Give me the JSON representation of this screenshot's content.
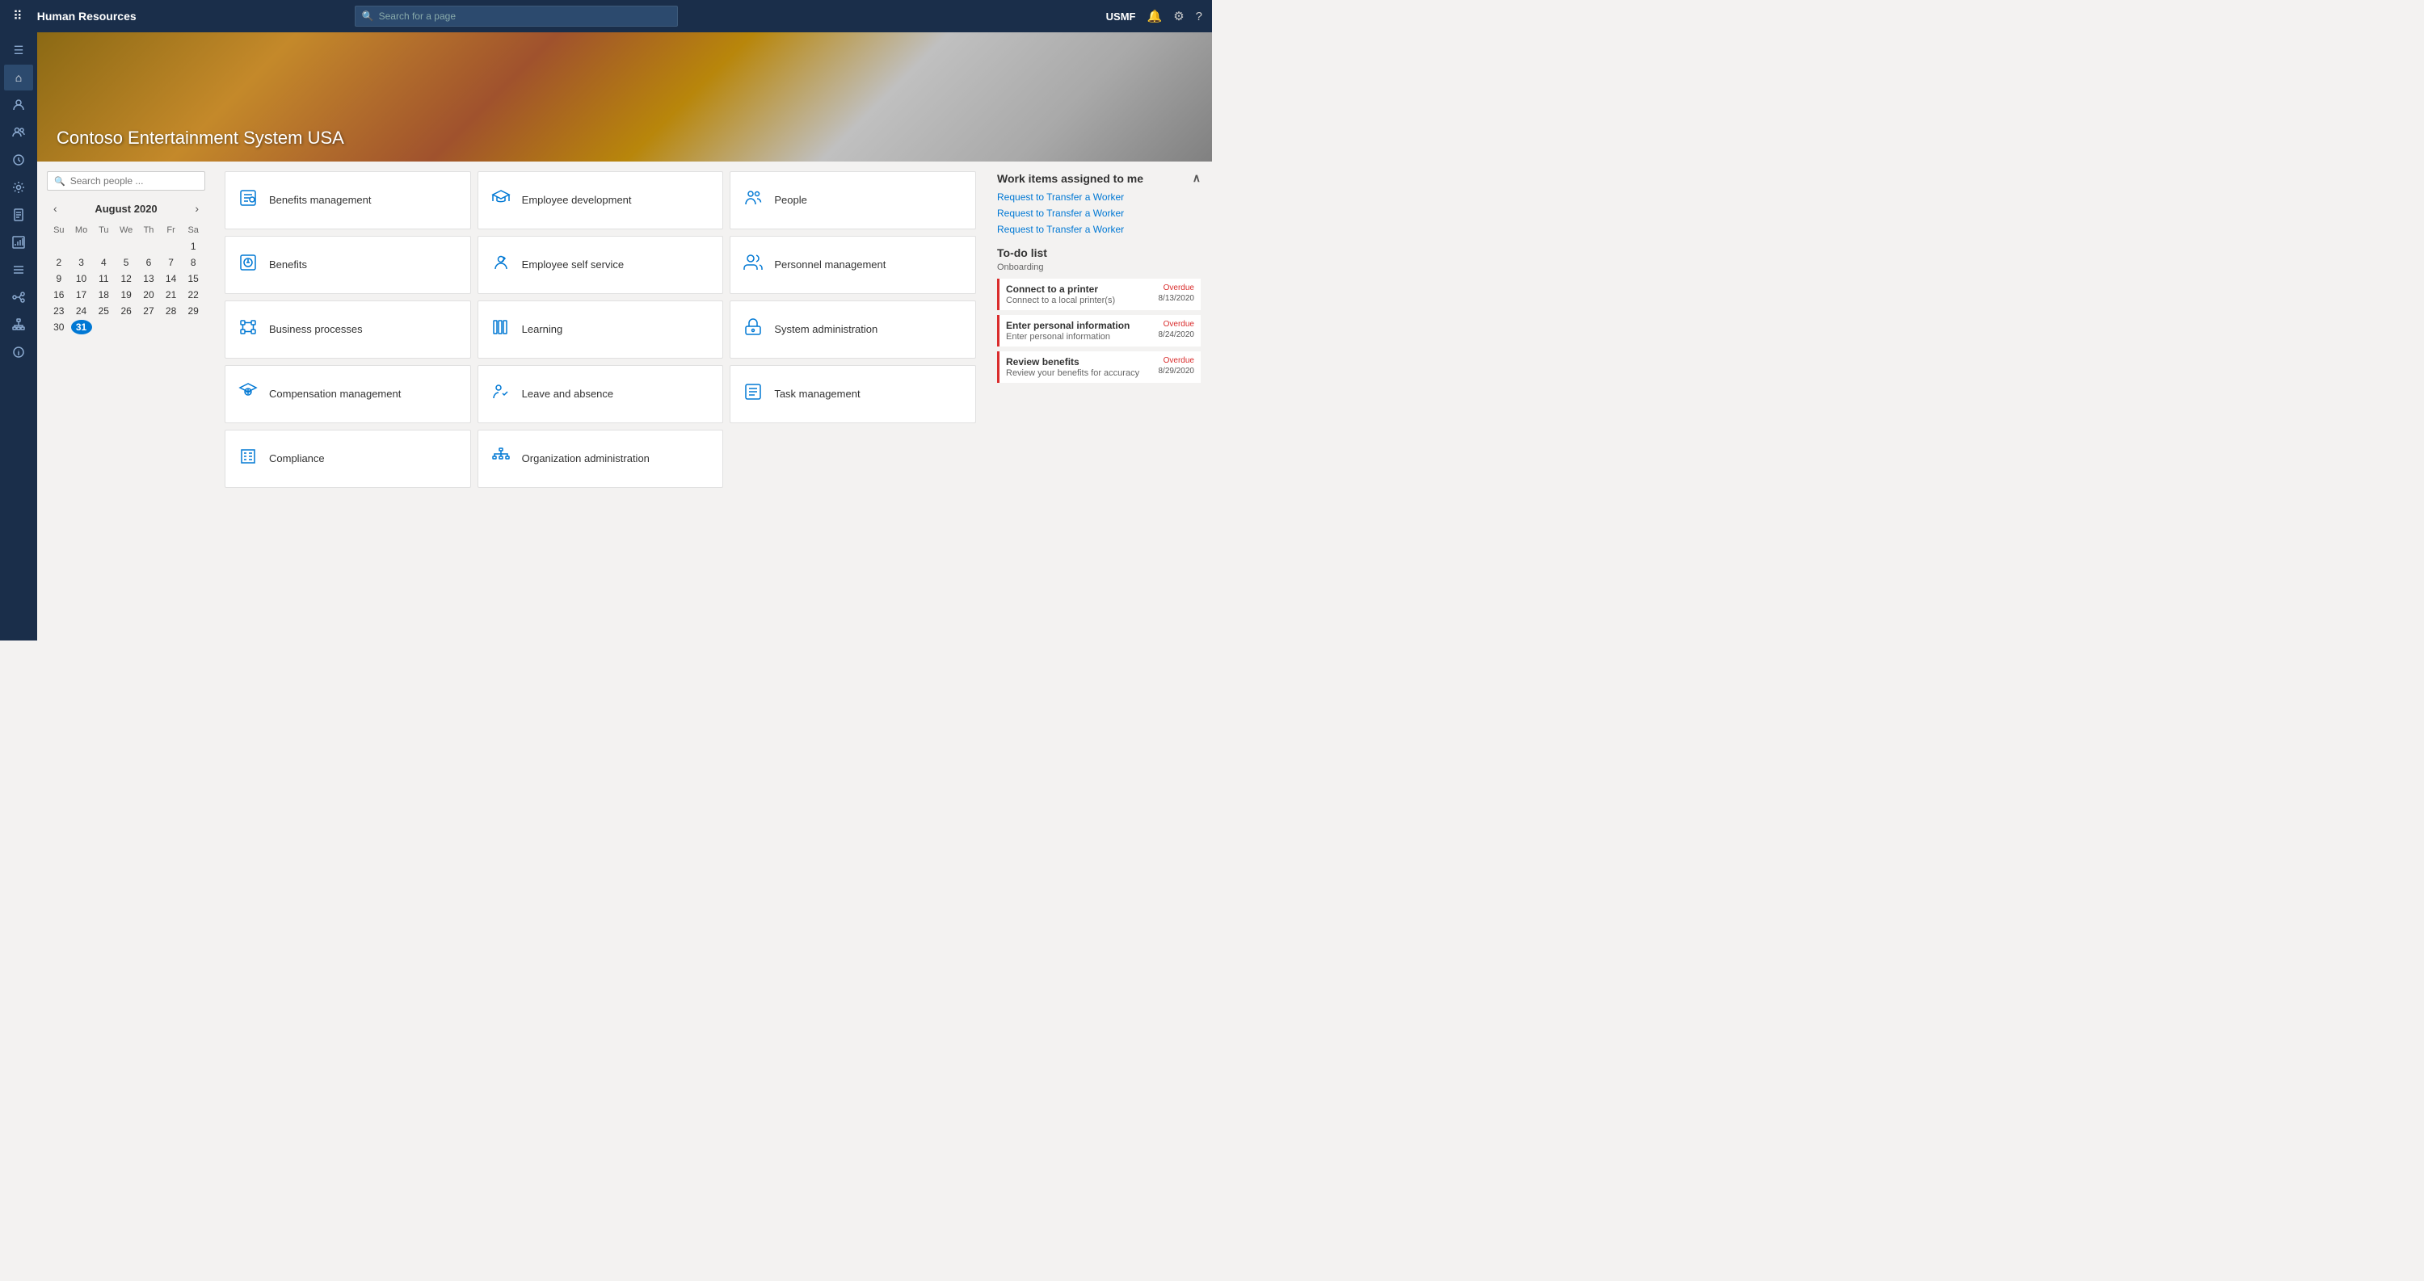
{
  "topNav": {
    "title": "Human Resources",
    "searchPlaceholder": "Search for a page",
    "company": "USMF"
  },
  "hero": {
    "title": "Contoso Entertainment System USA"
  },
  "searchPeople": {
    "placeholder": "Search people ..."
  },
  "calendar": {
    "month": "August",
    "year": "2020",
    "days": [
      "Su",
      "Mo",
      "Tu",
      "We",
      "Th",
      "Fr",
      "Sa"
    ],
    "weeks": [
      [
        "",
        "",
        "",
        "",
        "",
        "",
        "1"
      ],
      [
        "2",
        "3",
        "4",
        "5",
        "6",
        "7",
        "8"
      ],
      [
        "9",
        "10",
        "11",
        "12",
        "13",
        "14",
        "15"
      ],
      [
        "16",
        "17",
        "18",
        "19",
        "20",
        "21",
        "22"
      ],
      [
        "23",
        "24",
        "25",
        "26",
        "27",
        "28",
        "29"
      ],
      [
        "30",
        "31",
        "",
        "",
        "",
        "",
        ""
      ]
    ],
    "today": "31"
  },
  "tiles": [
    {
      "id": "benefits-management",
      "label": "Benefits management",
      "icon": "bm"
    },
    {
      "id": "employee-development",
      "label": "Employee development",
      "icon": "ed"
    },
    {
      "id": "people",
      "label": "People",
      "icon": "people"
    },
    {
      "id": "benefits",
      "label": "Benefits",
      "icon": "ben"
    },
    {
      "id": "employee-self-service",
      "label": "Employee self service",
      "icon": "ess"
    },
    {
      "id": "personnel-management",
      "label": "Personnel management",
      "icon": "pm"
    },
    {
      "id": "business-processes",
      "label": "Business processes",
      "icon": "bp"
    },
    {
      "id": "learning",
      "label": "Learning",
      "icon": "learn"
    },
    {
      "id": "system-administration",
      "label": "System administration",
      "icon": "sa"
    },
    {
      "id": "compensation-management",
      "label": "Compensation management",
      "icon": "cm"
    },
    {
      "id": "leave-and-absence",
      "label": "Leave and absence",
      "icon": "la"
    },
    {
      "id": "task-management",
      "label": "Task management",
      "icon": "tm"
    },
    {
      "id": "compliance",
      "label": "Compliance",
      "icon": "comp"
    },
    {
      "id": "organization-administration",
      "label": "Organization administration",
      "icon": "oa"
    }
  ],
  "workItems": {
    "title": "Work items assigned to me",
    "items": [
      {
        "label": "Request to Transfer a Worker"
      },
      {
        "label": "Request to Transfer a Worker"
      },
      {
        "label": "Request to Transfer a Worker"
      }
    ]
  },
  "todoList": {
    "title": "To-do list",
    "subtitle": "Onboarding",
    "items": [
      {
        "title": "Connect to a printer",
        "desc": "Connect to a local printer(s)",
        "status": "Overdue",
        "date": "8/13/2020"
      },
      {
        "title": "Enter personal information",
        "desc": "Enter personal information",
        "status": "Overdue",
        "date": "8/24/2020"
      },
      {
        "title": "Review benefits",
        "desc": "Review your benefits for accuracy",
        "status": "Overdue",
        "date": "8/29/2020"
      }
    ]
  },
  "sidebar": {
    "items": [
      {
        "name": "hamburger-icon",
        "icon": "☰"
      },
      {
        "name": "home-icon",
        "icon": "⌂"
      },
      {
        "name": "person-icon",
        "icon": "👤"
      },
      {
        "name": "group-icon",
        "icon": "👥"
      },
      {
        "name": "clock-icon",
        "icon": "⏱"
      },
      {
        "name": "settings-icon",
        "icon": "⚙"
      },
      {
        "name": "document-icon",
        "icon": "📄"
      },
      {
        "name": "report-icon",
        "icon": "📊"
      },
      {
        "name": "list-icon",
        "icon": "≡"
      },
      {
        "name": "connect-icon",
        "icon": "🔗"
      },
      {
        "name": "org-icon",
        "icon": "⊞"
      },
      {
        "name": "info-icon",
        "icon": "ℹ"
      }
    ]
  }
}
